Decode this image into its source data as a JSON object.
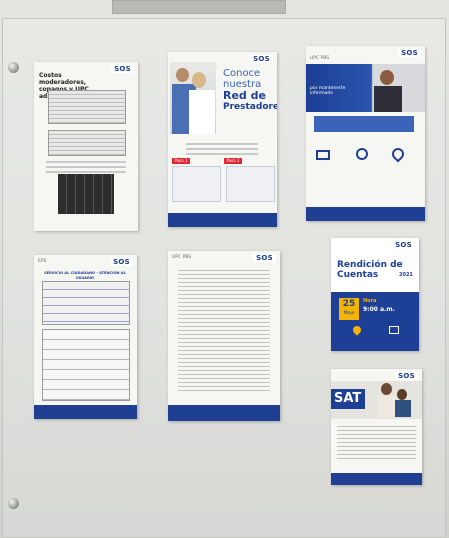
{
  "scene": "Glass display board with informational posters on a wall",
  "posters": [
    {
      "logo": "SOS",
      "title": "Costos moderadores, copagos y UPC adicional 2022"
    },
    {
      "logo": "SOS",
      "heading_1": "Conoce",
      "heading_2": "nuestra",
      "heading_3": "Red de",
      "heading_4": "Prestadores",
      "step_1": "Paso 1",
      "step_2": "Paso 2"
    },
    {
      "logo": "SOS",
      "mini": "UPC PBS",
      "note": "por mantenerte informado"
    },
    {
      "logo": "SOS",
      "mini": "EPS",
      "form_title": "SERVICIO AL CIUDADANO - ATENCIÓN AL USUARIO"
    },
    {
      "logo": "SOS",
      "mini": "UPC PBS"
    },
    {
      "logo": "SOS",
      "heading": "Rendición de Cuentas",
      "year": "2021",
      "date_day": "25",
      "date_month": "Mayo",
      "time_label": "Hora",
      "time_value": "9:00 a.m."
    },
    {
      "logo": "SOS",
      "heading": "SAT"
    }
  ]
}
